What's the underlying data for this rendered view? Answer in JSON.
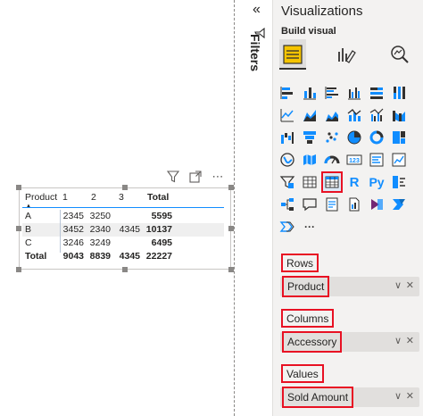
{
  "matrix": {
    "header": [
      "Product",
      "1",
      "2",
      "3",
      "Total"
    ],
    "rows": [
      {
        "product": "A",
        "c1": "2345",
        "c2": "3250",
        "c3": "",
        "total": "5595"
      },
      {
        "product": "B",
        "c1": "3452",
        "c2": "2340",
        "c3": "4345",
        "total": "10137"
      },
      {
        "product": "C",
        "c1": "3246",
        "c2": "3249",
        "c3": "",
        "total": "6495"
      }
    ],
    "total_row": {
      "label": "Total",
      "c1": "9043",
      "c2": "8839",
      "c3": "4345",
      "total": "22227"
    }
  },
  "visual_toolbar": {
    "icons": [
      "filter-icon",
      "focus-mode-icon",
      "more-options-icon"
    ],
    "more_glyph": "⋯"
  },
  "filters": {
    "collapse_glyph": "«",
    "label": "Filters"
  },
  "visualizations": {
    "title": "Visualizations",
    "subtitle": "Build visual",
    "tabs": [
      "build-visual-tab",
      "format-visual-tab",
      "analytics-tab"
    ],
    "icon_names": [
      "stacked-bar-chart-icon",
      "stacked-column-chart-icon",
      "clustered-bar-chart-icon",
      "clustered-column-chart-icon",
      "100-stacked-bar-chart-icon",
      "100-stacked-column-chart-icon",
      "line-chart-icon",
      "area-chart-icon",
      "stacked-area-chart-icon",
      "line-and-stacked-column-icon",
      "line-and-clustered-column-icon",
      "ribbon-chart-icon",
      "waterfall-chart-icon",
      "funnel-chart-icon",
      "scatter-chart-icon",
      "pie-chart-icon",
      "donut-chart-icon",
      "treemap-icon",
      "map-icon",
      "filled-map-icon",
      "gauge-icon",
      "card-icon",
      "multi-row-card-icon",
      "kpi-icon",
      "slicer-icon",
      "table-icon",
      "matrix-icon",
      "r-visual-icon",
      "python-visual-icon",
      "key-influencers-icon",
      "decomposition-tree-icon",
      "qna-icon",
      "smart-narrative-icon",
      "paginated-report-icon",
      "power-apps-icon",
      "power-automate-icon",
      "more-visuals-icon",
      "more-options-icon"
    ],
    "glyphs": {
      "r": "R",
      "python": "Py",
      "card": "123",
      "more": "···"
    },
    "selected_icon": "matrix-icon"
  },
  "wells": [
    {
      "label": "Rows",
      "field": "Product"
    },
    {
      "label": "Columns",
      "field": "Accessory"
    },
    {
      "label": "Values",
      "field": "Sold Amount"
    }
  ],
  "field_controls": {
    "chevron": "∨",
    "remove": "✕"
  },
  "colors": {
    "accent": "#118dff",
    "highlight": "#e81123",
    "pane_background": "#f3f2f1",
    "field_background": "#e1dfdd",
    "icon_blue": "#118dff",
    "icon_dark": "#323130"
  }
}
